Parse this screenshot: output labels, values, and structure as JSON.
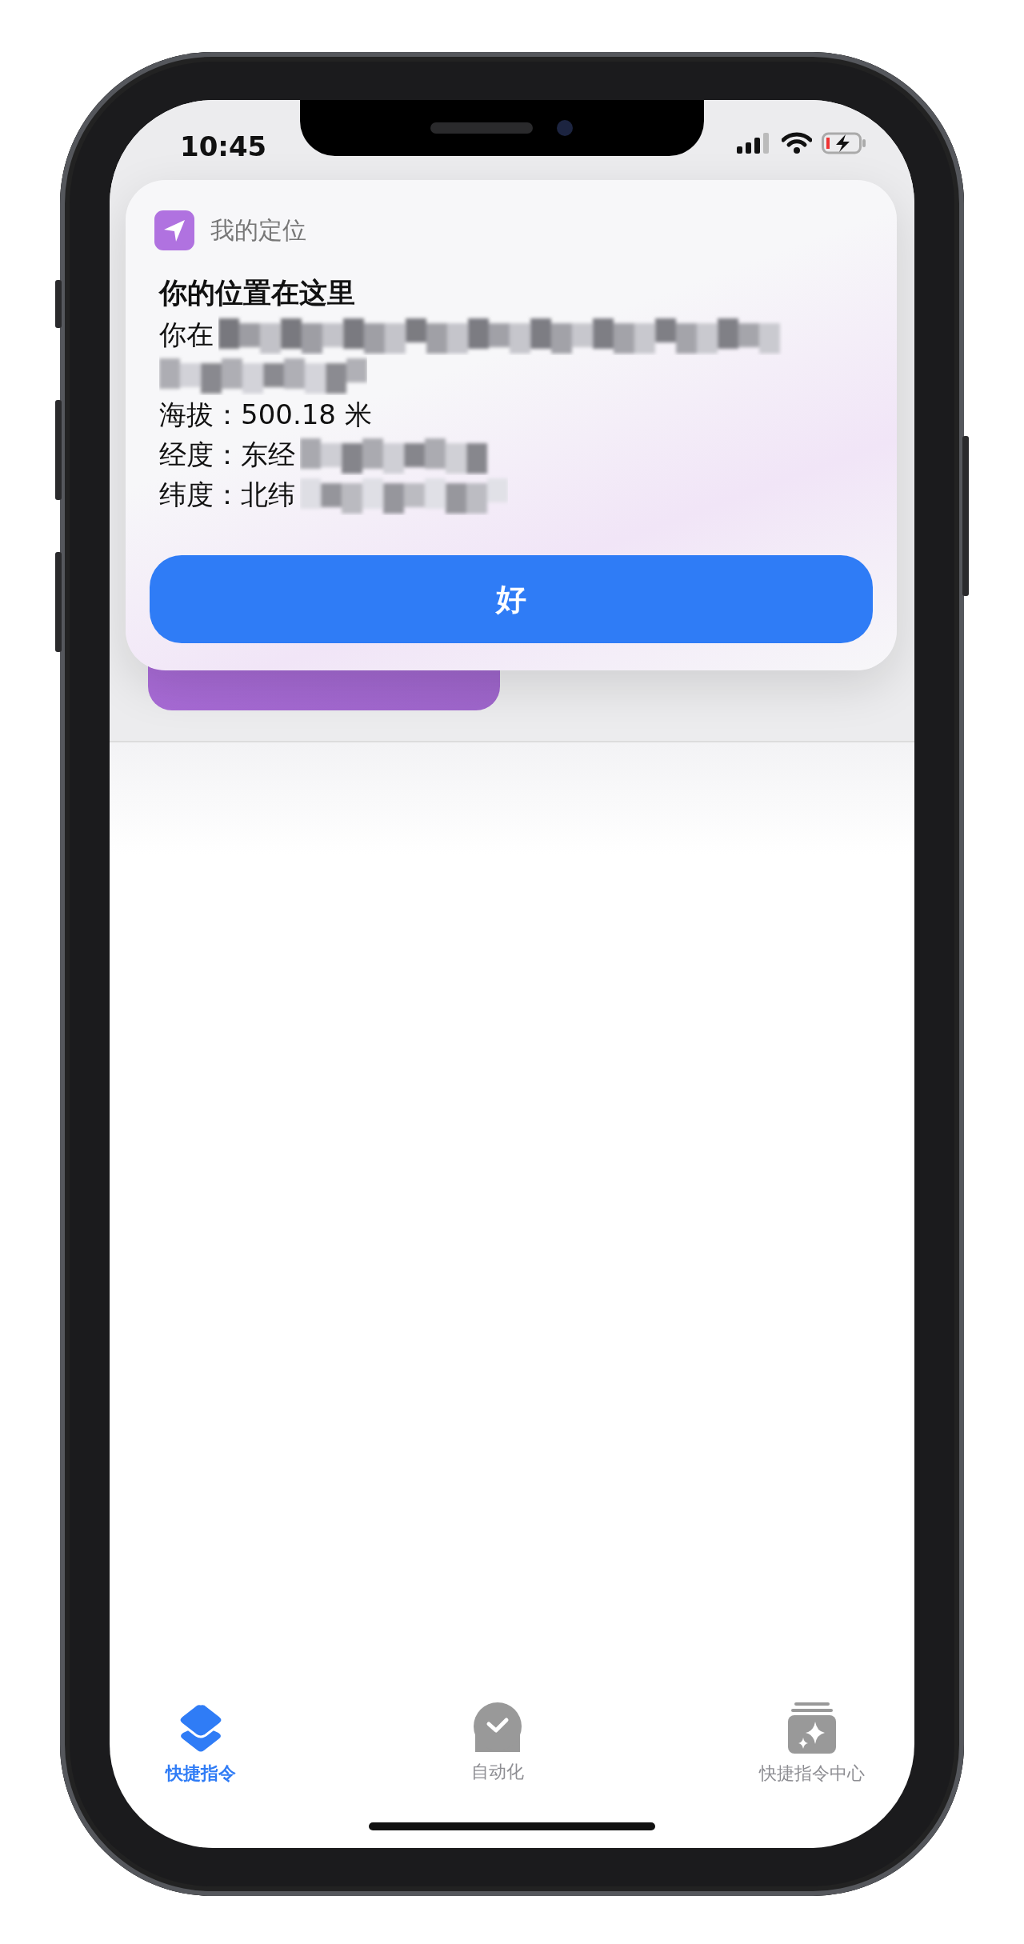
{
  "status_bar": {
    "time": "10:45"
  },
  "alert": {
    "app_name": "我的定位",
    "title": "你的位置在这里",
    "lines": [
      {
        "text": "你在",
        "blurred": true
      },
      {
        "blurred": true
      },
      {
        "text": "海拔：500.18 米",
        "blurred": false
      },
      {
        "text": "经度：东经",
        "blurred": true
      },
      {
        "text": "纬度：北纬",
        "blurred": true
      }
    ],
    "button": "好"
  },
  "tabs": [
    {
      "label": "快捷指令",
      "selected": true,
      "kind": "layers"
    },
    {
      "label": "自动化",
      "selected": false,
      "kind": "clock"
    },
    {
      "label": "快捷指令中心",
      "selected": false,
      "kind": "gallery"
    }
  ]
}
